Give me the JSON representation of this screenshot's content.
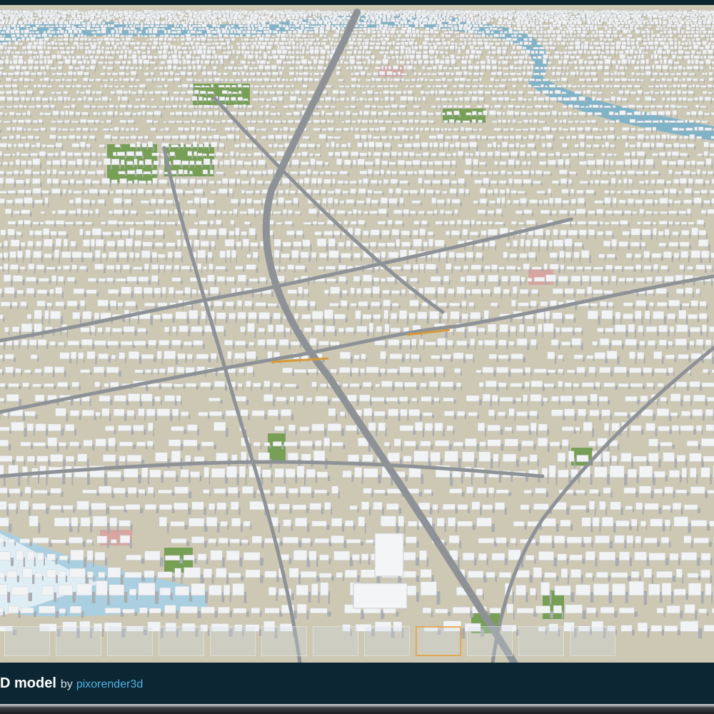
{
  "caption": {
    "title": "D model",
    "by": "by",
    "author": "pixorender3d"
  },
  "viewer": {
    "scene": "3d-city-render",
    "thumbnail_count": 12,
    "active_thumbnail": 8
  },
  "colors": {
    "caption_bar": "#0c2633",
    "author_link": "#4fb3e6",
    "ground": "#cdc8b4",
    "water": "#7fb3c8",
    "road": "#8e9297",
    "building": "#f2f3f5"
  }
}
